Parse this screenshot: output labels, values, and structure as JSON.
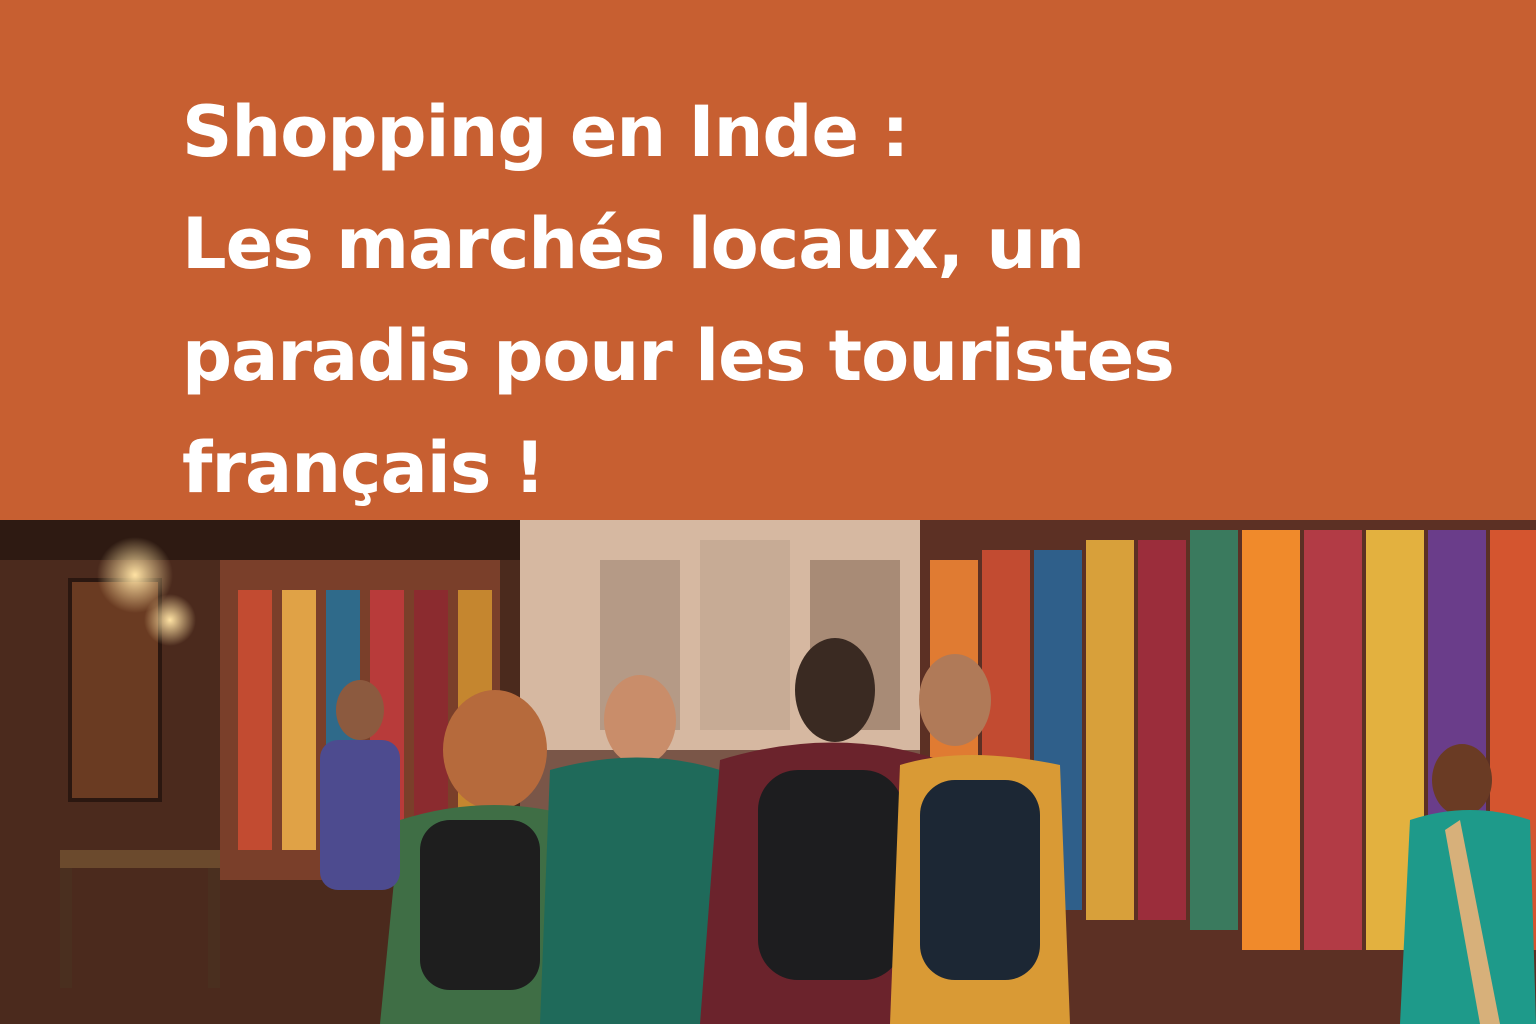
{
  "headline": {
    "line1": "Shopping en Inde :",
    "line2": "Les marchés locaux, un",
    "line3": "paradis pour les touristes",
    "line4": "français !"
  },
  "colors": {
    "banner": "#c75f31",
    "text": "#ffffff"
  },
  "photo": {
    "subject": "market-street-with-tourists"
  }
}
